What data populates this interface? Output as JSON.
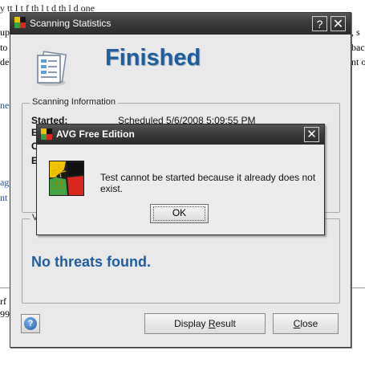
{
  "background": {
    "lines": [
      "y  tt  I  t                  f        th   l  t    d           th  l  d  one",
      "up",
      "to",
      "de"
    ],
    "right_fragments": [
      ", s",
      "bac",
      "nt o"
    ],
    "left_fragments": [
      "ne",
      "ag",
      "nt",
      "rf",
      "99"
    ]
  },
  "main_window": {
    "title": "Scanning Statistics",
    "help_glyph": "?",
    "close_glyph": "✕",
    "heading": "Finished",
    "info_group": {
      "label": "Scanning Information",
      "started_label": "Started:",
      "started_value": "Scheduled 5/6/2008 5:09:55 PM",
      "hidden_labels": [
        "E",
        "C",
        "E"
      ]
    },
    "results_group": {
      "label": "V",
      "message": "No threats found."
    },
    "buttons": {
      "help_glyph": "?",
      "display_result_pre": "Display ",
      "display_result_u": "R",
      "display_result_post": "esult",
      "close_u": "C",
      "close_post": "lose"
    },
    "icons": {
      "title": "avg-logo-icon",
      "doc": "document-stats-icon",
      "help": "help-icon"
    }
  },
  "dialog": {
    "title": "AVG Free Edition",
    "close_glyph": "✕",
    "message": "Test cannot be started because it already does not exist.",
    "ok_label": "OK",
    "icon": "avg-logo-icon"
  },
  "colors": {
    "accent": "#1f5e9e",
    "titlebar": "#333333",
    "window": "#e9e9e9"
  }
}
